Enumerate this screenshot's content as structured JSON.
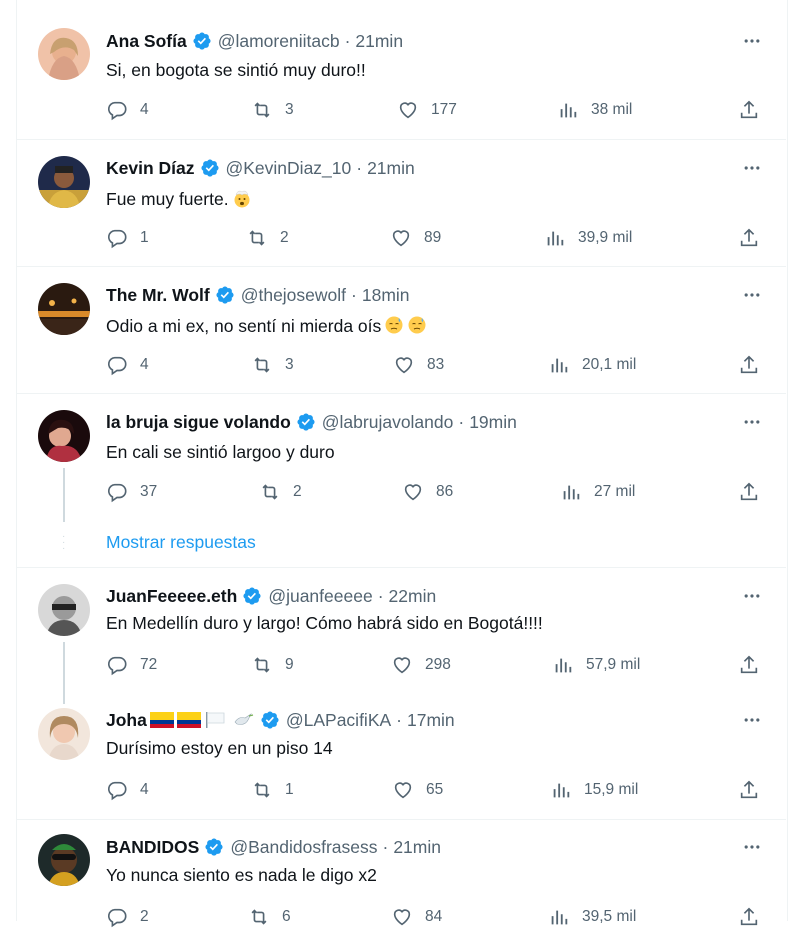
{
  "tweets": [
    {
      "name": "Ana Sofía",
      "handle": "@lamoreniitacb",
      "time": "21min",
      "text": "Si, en bogota se sintió muy duro!!",
      "replies": "4",
      "retweets": "3",
      "likes": "177",
      "views": "38 mil"
    },
    {
      "name": "Kevin Díaz",
      "handle": "@KevinDiaz_10",
      "time": "21min",
      "text": "Fue muy fuerte.",
      "emoji": "exploding-head-emoji",
      "replies": "1",
      "retweets": "2",
      "likes": "89",
      "views": "39,9 mil"
    },
    {
      "name": "The Mr. Wolf",
      "handle": "@thejosewolf",
      "time": "18min",
      "text": "Odio a mi ex, no sentí ni mierda oís",
      "emoji": "downcast-sweat-emoji",
      "replies": "4",
      "retweets": "3",
      "likes": "83",
      "views": "20,1 mil"
    },
    {
      "name": "la bruja sigue volando",
      "handle": "@labrujavolando",
      "time": "19min",
      "text": "En cali se sintió largoo y duro",
      "replies": "37",
      "retweets": "2",
      "likes": "86",
      "views": "27 mil"
    },
    {
      "name": "JuanFeeeee.eth",
      "handle": "@juanfeeeee",
      "time": "22min",
      "text": "En Medellín duro y largo! Cómo habrá sido en Bogotá!!!!",
      "replies": "72",
      "retweets": "9",
      "likes": "298",
      "views": "57,9 mil"
    },
    {
      "name": "Joha",
      "handle": "@LAPacifiKA",
      "time": "17min",
      "text": "Durísimo estoy en un piso 14",
      "replies": "4",
      "retweets": "1",
      "likes": "65",
      "views": "15,9 mil"
    },
    {
      "name": "BANDIDOS",
      "handle": "@Bandidosfrasess",
      "time": "21min",
      "text": "Yo nunca siento es nada le digo x2",
      "replies": "2",
      "retweets": "6",
      "likes": "84",
      "views": "39,5 mil"
    }
  ],
  "show_replies": "Mostrar respuestas",
  "colors": {
    "accent": "#1d9bf0",
    "muted": "#536471",
    "text": "#0f1419",
    "border": "#eff3f4"
  }
}
